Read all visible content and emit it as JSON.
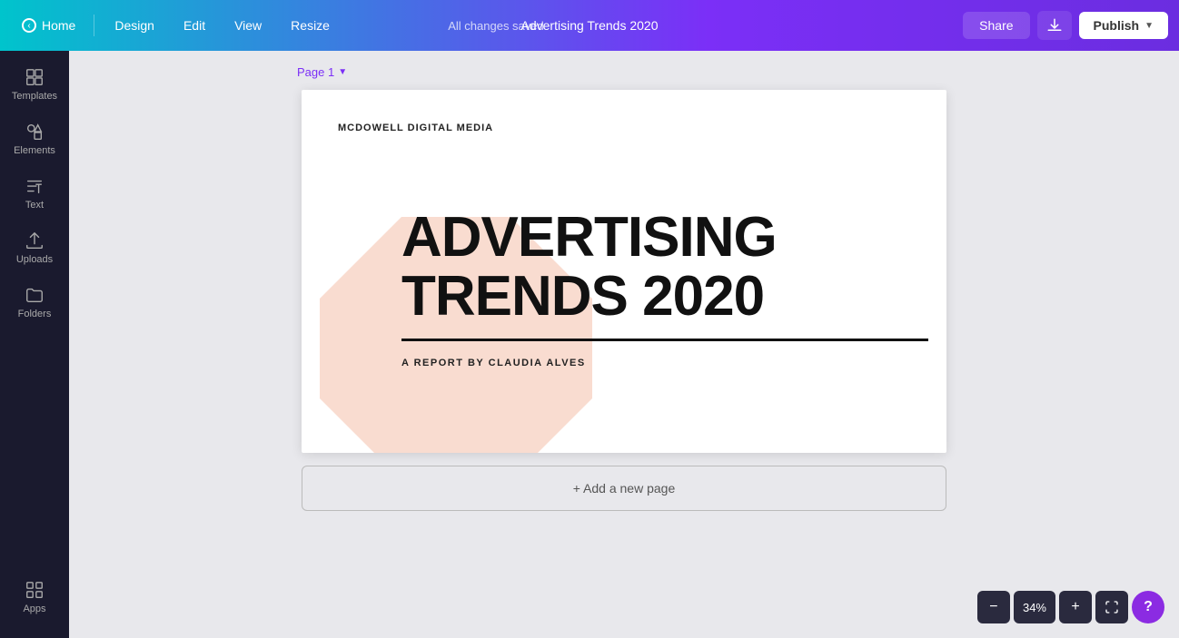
{
  "nav": {
    "home_label": "Home",
    "design_label": "Design",
    "edit_label": "Edit",
    "view_label": "View",
    "resize_label": "Resize",
    "status_text": "All changes saved",
    "doc_title": "Advertising Trends 2020",
    "share_label": "Share",
    "publish_label": "Publish"
  },
  "sidebar": {
    "templates_label": "Templates",
    "elements_label": "Elements",
    "text_label": "Text",
    "uploads_label": "Uploads",
    "folders_label": "Folders",
    "apps_label": "Apps"
  },
  "canvas": {
    "page_label": "Page 1",
    "company_name": "MCDOWELL DIGITAL MEDIA",
    "main_title_line1": "ADVERTISING",
    "main_title_line2": "TRENDS 2020",
    "subtitle": "A REPORT BY CLAUDIA ALVES",
    "add_page_label": "+ Add a new page"
  },
  "zoom": {
    "value": "34%",
    "minus_label": "−",
    "plus_label": "+"
  },
  "colors": {
    "brand_purple": "#7b2ff7",
    "brand_teal": "#00c4cc",
    "shape_peach": "#f5c5b0"
  }
}
